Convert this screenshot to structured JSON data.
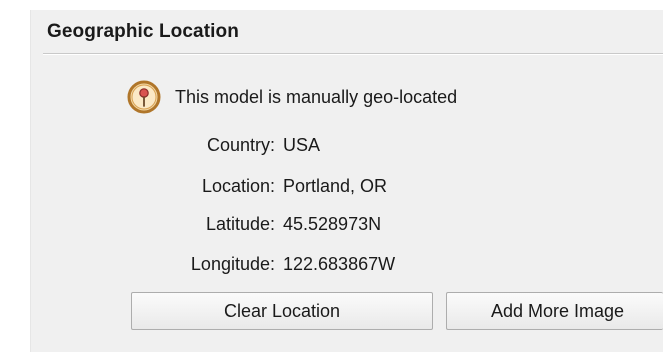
{
  "section": {
    "title": "Geographic Location"
  },
  "status": {
    "icon": "location-pin-icon",
    "text": "This model is manually geo-located"
  },
  "fields": [
    {
      "label": "Country:",
      "value": "USA"
    },
    {
      "label": "Location:",
      "value": "Portland, OR"
    },
    {
      "label": "Latitude:",
      "value": "45.528973N"
    },
    {
      "label": "Longitude:",
      "value": "122.683867W"
    }
  ],
  "buttons": {
    "clear_location": "Clear Location",
    "add_more_images": "Add More Image"
  },
  "colors": {
    "panel_background": "#f0f0f0",
    "pin_ring": "#c88a2a",
    "pin_fill": "#f2d9a8",
    "pin_head": "#d9534f"
  }
}
